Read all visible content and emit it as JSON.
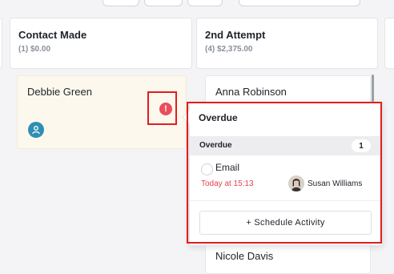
{
  "columns": [
    {
      "title": "Contact Made",
      "subtitle": "(1) $0.00"
    },
    {
      "title": "2nd Attempt",
      "subtitle": "(4) $2,375.00"
    }
  ],
  "cards": {
    "debbie": {
      "name": "Debbie Green",
      "alert_symbol": "!"
    },
    "anna": {
      "name": "Anna Robinson"
    },
    "partial_bottom": {
      "name": "Nicole Davis"
    }
  },
  "popover": {
    "title": "Overdue",
    "section_label": "Overdue",
    "section_count": "1",
    "activity": {
      "type": "Email",
      "time": "Today at 15:13",
      "owner": "Susan Williams"
    },
    "schedule_button": "+ Schedule Activity"
  },
  "colors": {
    "alert": "#ea4d5b",
    "overdue_text": "#e0464f",
    "highlight_box": "#e21d1d",
    "avatar_teal": "#2f8fb3",
    "card_tint": "#fdf8ee"
  },
  "icons": [
    "person-icon",
    "alert-icon",
    "check-circle-icon",
    "plus-icon"
  ]
}
